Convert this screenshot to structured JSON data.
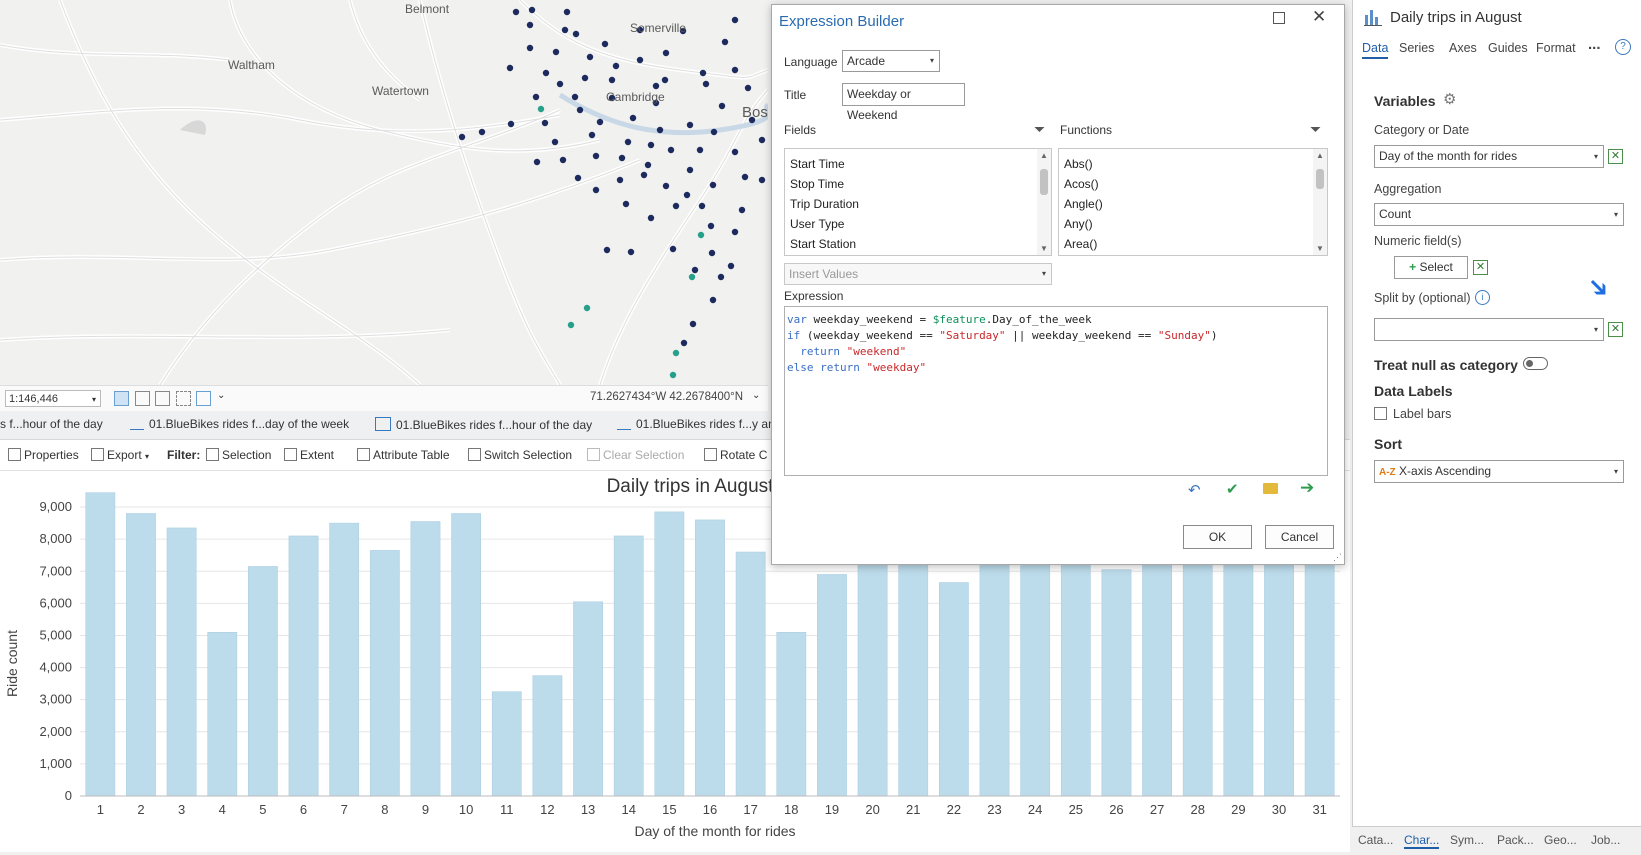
{
  "map": {
    "labels": [
      "Belmont",
      "Somerville",
      "Waltham",
      "Watertown",
      "Cambridge",
      "Bos"
    ],
    "scale": "1:146,446",
    "coordinates": "71.2627434°W 42.2678400°N"
  },
  "view_tabs": [
    "s f...hour of the day",
    "01.BlueBikes rides f...day of the week",
    "01.BlueBikes rides f...hour of the day",
    "01.BlueBikes rides f...y an"
  ],
  "chart_toolbar": {
    "properties": "Properties",
    "export": "Export",
    "filter": "Filter:",
    "selection": "Selection",
    "extent": "Extent",
    "attribute_table": "Attribute Table",
    "switch_selection": "Switch Selection",
    "clear_selection": "Clear Selection",
    "rotate": "Rotate C"
  },
  "dialog": {
    "title": "Expression Builder",
    "language_label": "Language",
    "language_value": "Arcade",
    "title_label": "Title",
    "title_value": "Weekday or Weekend",
    "fields_label": "Fields",
    "functions_label": "Functions",
    "fields": [
      "Start Time",
      "Stop Time",
      "Trip Duration",
      "User Type",
      "Start Station"
    ],
    "functions": [
      "Abs()",
      "Acos()",
      "Angle()",
      "Any()",
      "Area()"
    ],
    "insert_values": "Insert Values",
    "expression_label": "Expression",
    "code": {
      "l1_kw": "var",
      "l1_var": " weekday_weekend = ",
      "l1_feat": "$feature",
      "l1_rest": ".Day_of_the_week",
      "l2_kw": "if",
      "l2_a": " (weekday_weekend == ",
      "l2_s1": "\"Saturday\"",
      "l2_b": " || weekday_weekend == ",
      "l2_s2": "\"Sunday\"",
      "l2_c": ")",
      "l3_kw": "  return",
      "l3_s": " \"weekend\"",
      "l4_kw": "else return",
      "l4_s": " \"weekday\""
    },
    "ok": "OK",
    "cancel": "Cancel"
  },
  "pane": {
    "title": "Daily trips in August",
    "tabs": [
      "Data",
      "Series",
      "Axes",
      "Guides",
      "Format"
    ],
    "more": "...",
    "variables": "Variables",
    "category_label": "Category or Date",
    "category_value": "Day of the month for rides",
    "aggregation_label": "Aggregation",
    "aggregation_value": "Count",
    "numeric_label": "Numeric field(s)",
    "select": "Select",
    "split_label": "Split by (optional)",
    "treat_null": "Treat null as category",
    "data_labels": "Data Labels",
    "label_bars": "Label bars",
    "sort": "Sort",
    "sort_value": "X-axis Ascending",
    "bottom_tabs": [
      "Cata...",
      "Char...",
      "Sym...",
      "Pack...",
      "Geo...",
      "Job..."
    ]
  },
  "chart_data": {
    "type": "bar",
    "title": "Daily trips in August",
    "xlabel": "Day of the month for rides",
    "ylabel": "Ride count",
    "categories": [
      "1",
      "2",
      "3",
      "4",
      "5",
      "6",
      "7",
      "8",
      "9",
      "10",
      "11",
      "12",
      "13",
      "14",
      "15",
      "16",
      "17",
      "18",
      "19",
      "20",
      "21",
      "22",
      "23",
      "24",
      "25",
      "26",
      "27",
      "28",
      "29",
      "30",
      "31"
    ],
    "values": [
      9450,
      8800,
      8350,
      5100,
      7150,
      8100,
      8500,
      7650,
      8550,
      8800,
      3250,
      3750,
      6050,
      8100,
      8850,
      8600,
      7600,
      5100,
      6900,
      8500,
      8700,
      6650,
      8600,
      8700,
      7450,
      7050,
      8500,
      8700,
      8700,
      8750,
      8700
    ],
    "ylim": [
      0,
      9500
    ],
    "yticks": [
      "0",
      "1,000",
      "2,000",
      "3,000",
      "4,000",
      "5,000",
      "6,000",
      "7,000",
      "8,000",
      "9,000"
    ],
    "bar_color": "#bcdbeb"
  }
}
